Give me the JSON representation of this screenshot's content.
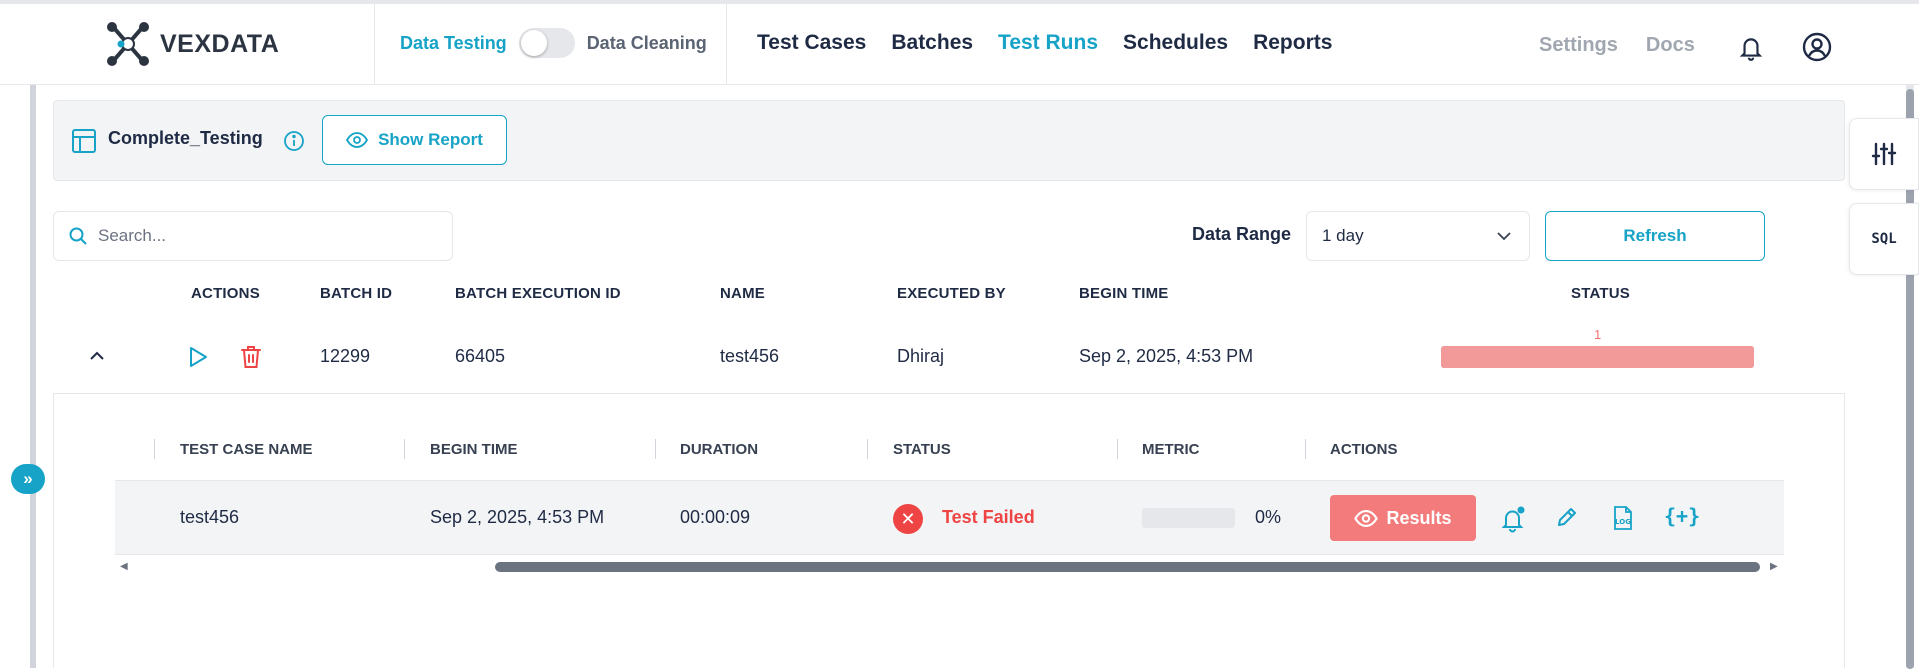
{
  "header": {
    "logo_text": "VEXDATA",
    "mode_active": "Data Testing",
    "mode_inactive": "Data Cleaning",
    "nav": [
      {
        "label": "Test Cases",
        "active": false
      },
      {
        "label": "Batches",
        "active": false
      },
      {
        "label": "Test Runs",
        "active": true
      },
      {
        "label": "Schedules",
        "active": false
      },
      {
        "label": "Reports",
        "active": false
      }
    ],
    "right_nav": [
      "Settings",
      "Docs"
    ],
    "icons": [
      "bell-icon",
      "user-icon"
    ]
  },
  "side_buttons": {
    "filter_icon": "sliders-icon",
    "sql_label": "SQL"
  },
  "panel": {
    "title": "Complete_Testing",
    "show_report_label": "Show Report"
  },
  "toolbar": {
    "search_placeholder": "Search...",
    "range_label": "Data Range",
    "range_value": "1 day",
    "refresh_label": "Refresh"
  },
  "table": {
    "columns": [
      "ACTIONS",
      "BATCH ID",
      "BATCH EXECUTION ID",
      "NAME",
      "EXECUTED BY",
      "BEGIN TIME",
      "STATUS"
    ],
    "rows": [
      {
        "batch_id": "12299",
        "batch_execution_id": "66405",
        "name": "test456",
        "executed_by": "Dhiraj",
        "begin_time": "Sep 2, 2025, 4:53 PM",
        "status_failed_count": "1",
        "status_failed_fraction": 1.0
      }
    ]
  },
  "subtable": {
    "columns": [
      "TEST CASE NAME",
      "BEGIN TIME",
      "DURATION",
      "STATUS",
      "METRIC",
      "ACTIONS"
    ],
    "rows": [
      {
        "test_case_name": "test456",
        "begin_time": "Sep 2, 2025, 4:53 PM",
        "duration": "00:00:09",
        "status": "Test Failed",
        "metric_percent": 0,
        "metric_label": "0%",
        "results_label": "Results",
        "log_label": "LOG",
        "json_label": "{+}"
      }
    ]
  },
  "colors": {
    "accent": "#16a3c7",
    "failed": "#ef4444",
    "failed_bar": "#f2999a",
    "results_button": "#f47b7b"
  }
}
